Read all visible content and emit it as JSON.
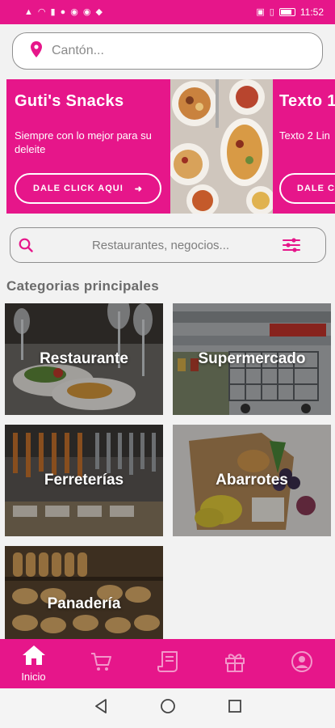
{
  "status_bar": {
    "time": "11:52"
  },
  "location": {
    "placeholder": "Cantón..."
  },
  "banner": {
    "slides": [
      {
        "title": "Guti's  Snacks",
        "text": "Siempre con lo mejor para su deleite",
        "button_label": "DALE CLICK AQUI"
      },
      {
        "title": "Texto 1",
        "text": "Texto 2 Lin",
        "button_label": "DALE C"
      }
    ]
  },
  "search": {
    "placeholder": "Restaurantes, negocios..."
  },
  "categories": {
    "title": "Categorias principales",
    "items": [
      {
        "label": "Restaurante"
      },
      {
        "label": "Supermercado"
      },
      {
        "label": "Ferreterías"
      },
      {
        "label": "Abarrotes"
      },
      {
        "label": "Panadería"
      }
    ]
  },
  "bottom_nav": {
    "items": [
      {
        "label": "Inicio",
        "icon": "home-icon"
      },
      {
        "label": "",
        "icon": "cart-icon"
      },
      {
        "label": "",
        "icon": "receipt-icon"
      },
      {
        "label": "",
        "icon": "gift-icon"
      },
      {
        "label": "",
        "icon": "user-icon"
      }
    ]
  },
  "colors": {
    "primary": "#e6168a",
    "background": "#f2f2f2"
  }
}
